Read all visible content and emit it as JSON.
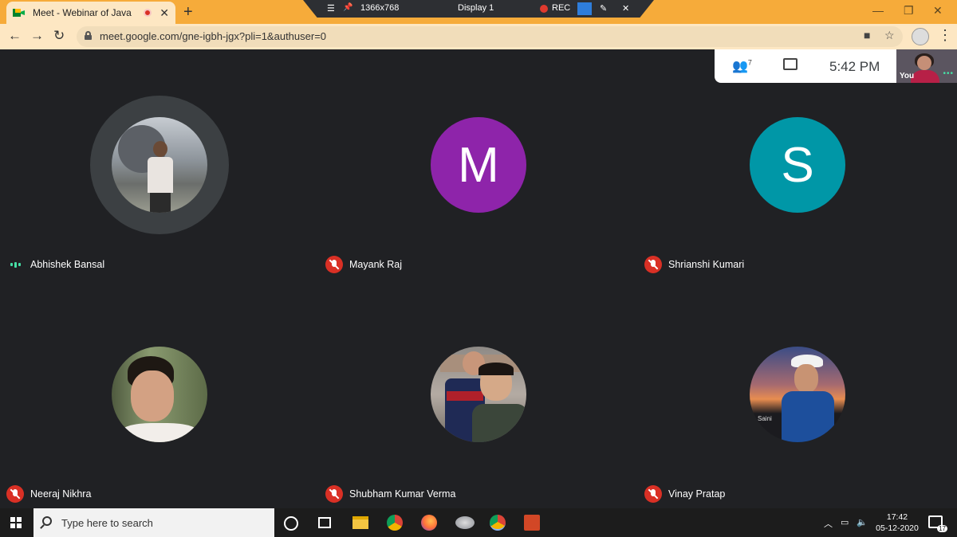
{
  "browser": {
    "tab_title": "Meet - Webinar of Java",
    "tab_close": "✕",
    "new_tab": "+",
    "url": "meet.google.com/gne-igbh-jgx?pli=1&authuser=0",
    "window_controls": [
      "—",
      "❐",
      "✕"
    ]
  },
  "recorder": {
    "menu": "☰",
    "pin": "📌",
    "resolution": "1366x768",
    "display": "Display 1",
    "rec": "REC",
    "pen": "✎",
    "close": "✕"
  },
  "meet": {
    "participant_count": "7",
    "time": "5:42  PM",
    "self_label": "You"
  },
  "participants": [
    {
      "name": "Abhishek Bansal",
      "avatar": "photo",
      "mic": "speaking"
    },
    {
      "name": "Mayank Raj",
      "avatar": "M",
      "avatar_color": "#8e24aa",
      "mic": "muted"
    },
    {
      "name": "Shrianshi Kumari",
      "avatar": "S",
      "avatar_color": "#0097a7",
      "mic": "muted"
    },
    {
      "name": "Neeraj Nikhra",
      "avatar": "photo",
      "mic": "muted"
    },
    {
      "name": "Shubham Kumar Verma",
      "avatar": "photo",
      "mic": "muted"
    },
    {
      "name": "Vinay Pratap",
      "avatar": "photo",
      "mic": "muted"
    }
  ],
  "taskbar": {
    "search_placeholder": "Type here to search",
    "clock_time": "17:42",
    "clock_date": "05-12-2020",
    "notification_count": "17"
  },
  "colors": {
    "meet_bg": "#202124",
    "tab_strip": "#f6ab3a",
    "muted": "#d93025",
    "speaking": "#46e0a6"
  }
}
